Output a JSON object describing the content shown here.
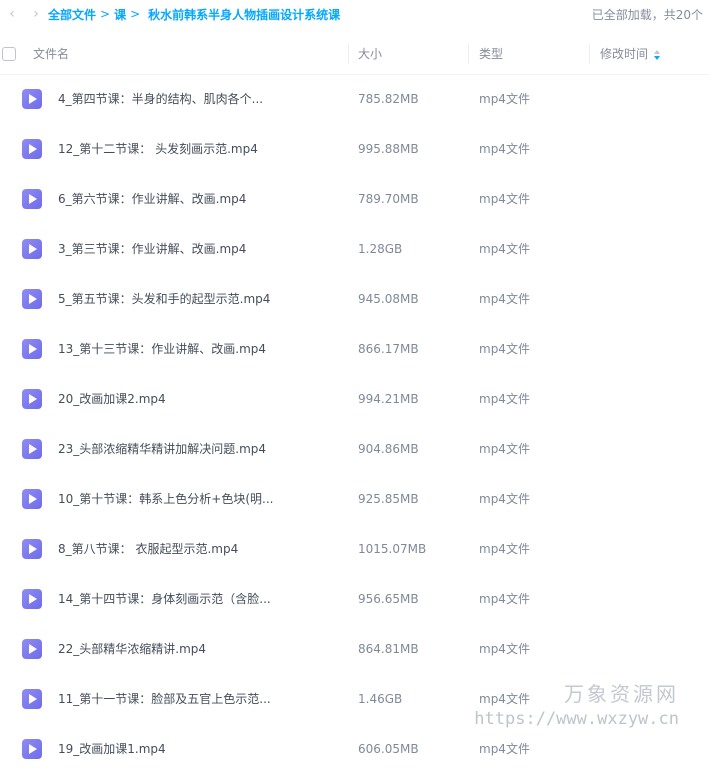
{
  "breadcrumb": {
    "root": "全部文件",
    "separator": ">",
    "parent": "课",
    "current": "秋水前韩系半身人物插画设计系统课"
  },
  "load_status": "已全部加载，共20个",
  "columns": {
    "name": "文件名",
    "size": "大小",
    "type": "类型",
    "modified": "修改时间"
  },
  "files": [
    {
      "name": "4_第四节课：半身的结构、肌肉各个...",
      "size": "785.82MB",
      "type": "mp4文件"
    },
    {
      "name": "12_第十二节课： 头发刻画示范.mp4",
      "size": "995.88MB",
      "type": "mp4文件"
    },
    {
      "name": "6_第六节课：作业讲解、改画.mp4",
      "size": "789.70MB",
      "type": "mp4文件"
    },
    {
      "name": "3_第三节课：作业讲解、改画.mp4",
      "size": "1.28GB",
      "type": "mp4文件"
    },
    {
      "name": "5_第五节课：头发和手的起型示范.mp4",
      "size": "945.08MB",
      "type": "mp4文件"
    },
    {
      "name": "13_第十三节课：作业讲解、改画.mp4",
      "size": "866.17MB",
      "type": "mp4文件"
    },
    {
      "name": "20_改画加课2.mp4",
      "size": "994.21MB",
      "type": "mp4文件"
    },
    {
      "name": "23_头部浓缩精华精讲加解决问题.mp4",
      "size": "904.86MB",
      "type": "mp4文件"
    },
    {
      "name": "10_第十节课：韩系上色分析+色块(明...",
      "size": "925.85MB",
      "type": "mp4文件"
    },
    {
      "name": "8_第八节课： 衣服起型示范.mp4",
      "size": "1015.07MB",
      "type": "mp4文件"
    },
    {
      "name": "14_第十四节课：身体刻画示范（含脸...",
      "size": "956.65MB",
      "type": "mp4文件"
    },
    {
      "name": "22_头部精华浓缩精讲.mp4",
      "size": "864.81MB",
      "type": "mp4文件"
    },
    {
      "name": "11_第十一节课：脸部及五官上色示范...",
      "size": "1.46GB",
      "type": "mp4文件"
    },
    {
      "name": "19_改画加课1.mp4",
      "size": "606.05MB",
      "type": "mp4文件"
    }
  ],
  "watermark": {
    "title": "万象资源网",
    "url": "https://www.wxzyw.cn"
  },
  "colors": {
    "accent": "#06a7ff",
    "video_icon": "#7a77ee"
  }
}
